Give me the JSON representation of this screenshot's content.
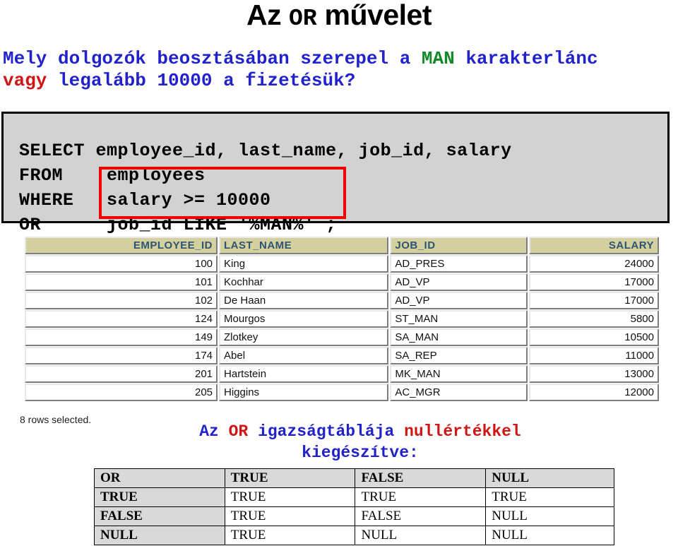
{
  "slide": {
    "title_before": "Az ",
    "title_keyword": "OR",
    "title_after": " művelet"
  },
  "question": {
    "line1_part1": "Mely dolgozók beosztásában szerepel a ",
    "line1_keyword": "MAN",
    "line1_part2": " karakterlánc",
    "line2_red": "vagy",
    "line2_rest": " legalább 10000 a fizetésük?",
    "color_text": "#2222cc",
    "color_red": "#d01515",
    "color_keyword": "#108a28"
  },
  "sql": {
    "code": "SELECT employee_id, last_name, job_id, salary\nFROM    employees\nWHERE   salary >= 10000\nOR      job_id LIKE '%MAN%' ;",
    "highlight_color": "#ee0000",
    "background": "#d2d2d2"
  },
  "results": {
    "columns": [
      "EMPLOYEE_ID",
      "LAST_NAME",
      "JOB_ID",
      "SALARY"
    ],
    "rows": [
      [
        "100",
        "King",
        "AD_PRES",
        "24000"
      ],
      [
        "101",
        "Kochhar",
        "AD_VP",
        "17000"
      ],
      [
        "102",
        "De Haan",
        "AD_VP",
        "17000"
      ],
      [
        "124",
        "Mourgos",
        "ST_MAN",
        "5800"
      ],
      [
        "149",
        "Zlotkey",
        "SA_MAN",
        "10500"
      ],
      [
        "174",
        "Abel",
        "SA_REP",
        "11000"
      ],
      [
        "201",
        "Hartstein",
        "MK_MAN",
        "13000"
      ],
      [
        "205",
        "Higgins",
        "AC_MGR",
        "12000"
      ]
    ],
    "footer_note": "8 rows selected.",
    "header_background": "#d5d0a0",
    "header_color": "#2d5472"
  },
  "truth_caption": {
    "p1": "Az ",
    "p2": "OR",
    "p3": " igazságtáblája ",
    "p4": "nullértékkel",
    "p5": "kiegészítve:"
  },
  "truth_table": {
    "header": [
      "OR",
      "TRUE",
      "FALSE",
      "NULL"
    ],
    "rows": [
      [
        "TRUE",
        "TRUE",
        "TRUE",
        "TRUE"
      ],
      [
        "FALSE",
        "TRUE",
        "FALSE",
        "NULL"
      ],
      [
        "NULL",
        "TRUE",
        "NULL",
        "NULL"
      ]
    ]
  }
}
